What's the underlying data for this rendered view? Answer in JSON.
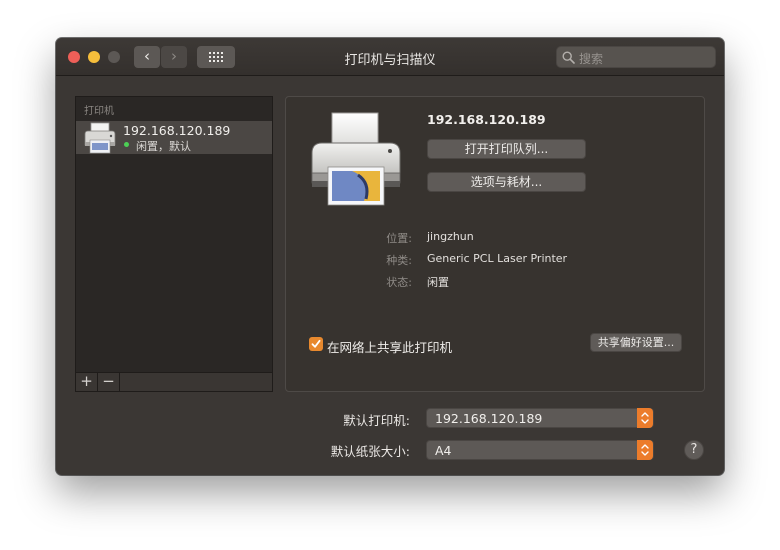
{
  "window": {
    "title": "打印机与扫描仪",
    "nav_back": "‹",
    "nav_forward": "›",
    "search_placeholder": "搜索"
  },
  "sidebar": {
    "header": "打印机",
    "printers": [
      {
        "name": "192.168.120.189",
        "status": "闲置，默认"
      }
    ],
    "add_label": "+",
    "remove_label": "−"
  },
  "detail": {
    "name": "192.168.120.189",
    "open_queue_label": "打开打印队列...",
    "options_label": "选项与耗材...",
    "info": [
      {
        "label": "位置:",
        "value": "jingzhun"
      },
      {
        "label": "种类:",
        "value": "Generic PCL Laser Printer"
      },
      {
        "label": "状态:",
        "value": "闲置"
      }
    ],
    "share_checkbox_label": "在网络上共享此打印机",
    "share_checked": true,
    "share_prefs_label": "共享偏好设置..."
  },
  "defaults": {
    "default_printer_label": "默认打印机:",
    "default_printer_value": "192.168.120.189",
    "default_paper_label": "默认纸张大小:",
    "default_paper_value": "A4"
  },
  "help_label": "?",
  "colors": {
    "accent": "#ec7c2b",
    "status_ok": "#4ccf55",
    "window_bg": "#3b3734"
  }
}
